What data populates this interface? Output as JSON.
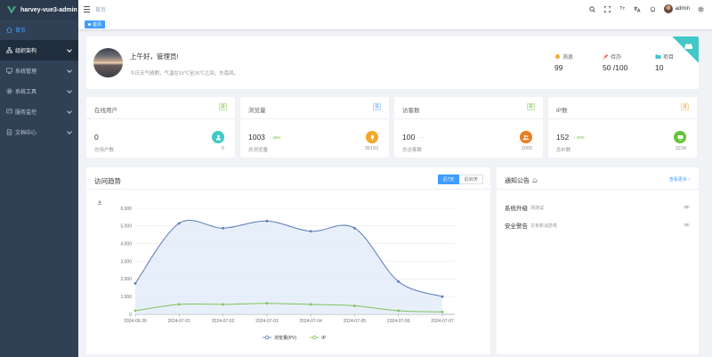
{
  "app": {
    "title": "harvey-vue3-admin"
  },
  "sidebar": {
    "items": [
      {
        "label": "首页",
        "icon": "home-icon"
      },
      {
        "label": "组织架构",
        "icon": "org-icon"
      },
      {
        "label": "系统管理",
        "icon": "system-icon"
      },
      {
        "label": "系统工具",
        "icon": "tools-icon"
      },
      {
        "label": "服务监控",
        "icon": "monitor-icon"
      },
      {
        "label": "文档中心",
        "icon": "doc-icon"
      }
    ]
  },
  "header": {
    "breadcrumb": "首页",
    "lang_glyph": "Tт",
    "user_name": "admin"
  },
  "tags": [
    {
      "label": "首页"
    }
  ],
  "welcome": {
    "greeting": "上午好，管理员!",
    "weather": "今日天气晴朗，气温在15℃至25℃之间，东南风。",
    "stats": [
      {
        "label": "消息",
        "value": "99",
        "icon": "bell-icon",
        "color": "#f2a92a"
      },
      {
        "label": "待办",
        "value": "50 /100",
        "icon": "pin-icon",
        "color": "#f56c6c"
      },
      {
        "label": "项目",
        "value": "10",
        "icon": "folder-icon",
        "color": "#40c9c6"
      }
    ],
    "corner_color": "#40c9c6"
  },
  "stat_cards": [
    {
      "title": "在线用户",
      "badge": "日",
      "badge_color": "#67c23a",
      "badge_bg": "#f0f9eb",
      "value": "0",
      "trend": "",
      "trend_kind": "none",
      "sub_label": "总用户数",
      "sub_value": "5",
      "circle_color": "#40c9c6",
      "icon": "user-icon"
    },
    {
      "title": "浏览量",
      "badge": "日",
      "badge_color": "#409eff",
      "badge_bg": "#ecf5ff",
      "value": "1003",
      "trend": "↑ 26%",
      "trend_kind": "up",
      "sub_label": "总浏览量",
      "sub_value": "36193",
      "circle_color": "#f2a92a",
      "icon": "eye-icon"
    },
    {
      "title": "访客数",
      "badge": "日",
      "badge_color": "#67c23a",
      "badge_bg": "#f0f9eb",
      "value": "100",
      "trend": "—",
      "trend_kind": "flat",
      "sub_label": "总访客数",
      "sub_value": "2000",
      "circle_color": "#e67e22",
      "icon": "visitor-icon"
    },
    {
      "title": "IP数",
      "badge": "日",
      "badge_color": "#e6a23c",
      "badge_bg": "#fdf6ec",
      "value": "152",
      "trend": "↑ 20%",
      "trend_kind": "up",
      "sub_label": "总IP数",
      "sub_value": "3234",
      "circle_color": "#67c23a",
      "icon": "monitor-icon"
    }
  ],
  "chart_card": {
    "title": "访问趋势",
    "range_options": [
      "近7天",
      "近30天"
    ],
    "selected_range": "近7天"
  },
  "chart_data": {
    "type": "line",
    "x": [
      "2024-06-30",
      "2024-07-01",
      "2024-07-02",
      "2024-07-03",
      "2024-07-04",
      "2024-07-05",
      "2024-07-06",
      "2024-07-07"
    ],
    "series": [
      {
        "name": "浏览量(PV)",
        "values": [
          1750,
          5150,
          4880,
          5280,
          4700,
          4880,
          1850,
          1000
        ],
        "color": "#5b7bb5",
        "area": true
      },
      {
        "name": "IP",
        "values": [
          200,
          560,
          560,
          620,
          560,
          480,
          200,
          130
        ],
        "color": "#7fc35a",
        "area": false
      }
    ],
    "ylim": [
      0,
      6000
    ],
    "yticks": [
      "0",
      "1,000",
      "2,000",
      "3,000",
      "4,000",
      "5,000",
      "6,000"
    ],
    "grid": true,
    "legend": "bottom"
  },
  "notice": {
    "title": "通知公告",
    "more_label": "查看更多",
    "items": [
      {
        "title": "系统升级",
        "sub": "测测试"
      },
      {
        "title": "安全警告",
        "sub": "又有新消息啦"
      }
    ]
  }
}
